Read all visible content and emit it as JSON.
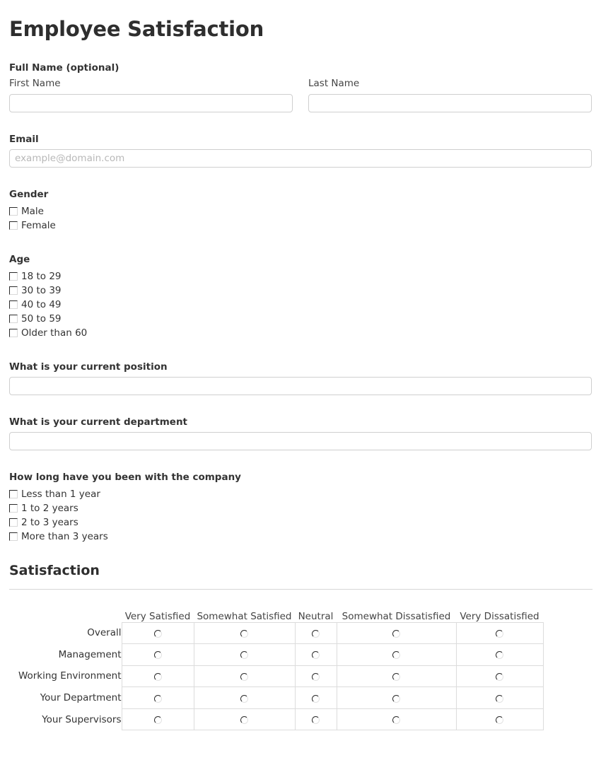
{
  "form": {
    "title": "Employee Satisfaction"
  },
  "full_name": {
    "group_label": "Full Name (optional)",
    "first": {
      "label": "First Name",
      "value": "",
      "placeholder": ""
    },
    "last": {
      "label": "Last Name",
      "value": "",
      "placeholder": ""
    }
  },
  "email": {
    "label": "Email",
    "value": "",
    "placeholder": "example@domain.com"
  },
  "gender": {
    "label": "Gender",
    "options": [
      {
        "label": "Male"
      },
      {
        "label": "Female"
      }
    ]
  },
  "age": {
    "label": "Age",
    "options": [
      {
        "label": "18 to 29"
      },
      {
        "label": "30 to 39"
      },
      {
        "label": "40 to 49"
      },
      {
        "label": "50 to 59"
      },
      {
        "label": "Older than 60"
      }
    ]
  },
  "position": {
    "label": "What is your current position",
    "value": "",
    "placeholder": ""
  },
  "department": {
    "label": "What is your current department",
    "value": "",
    "placeholder": ""
  },
  "tenure": {
    "label": "How long have you been with the company",
    "options": [
      {
        "label": "Less than 1 year"
      },
      {
        "label": "1 to 2 years"
      },
      {
        "label": "2 to 3 years"
      },
      {
        "label": "More than 3 years"
      }
    ]
  },
  "satisfaction": {
    "section_title": "Satisfaction",
    "columns": [
      "Very Satisfied",
      "Somewhat Satisfied",
      "Neutral",
      "Somewhat Dissatisfied",
      "Very Dissatisfied"
    ],
    "rows": [
      {
        "label": "Overall",
        "selected": null
      },
      {
        "label": "Management",
        "selected": null
      },
      {
        "label": "Working Environment",
        "selected": null
      },
      {
        "label": "Your Department",
        "selected": null
      },
      {
        "label": "Your Supervisors",
        "selected": null
      }
    ]
  },
  "theme": {
    "background": "#ffffff",
    "text": "#333333",
    "heading": "#2e2e2e",
    "border": "#cfcfcf",
    "table_border": "#dcdcdc",
    "placeholder": "#b8b8b8",
    "divider": "#d6d6d6"
  }
}
